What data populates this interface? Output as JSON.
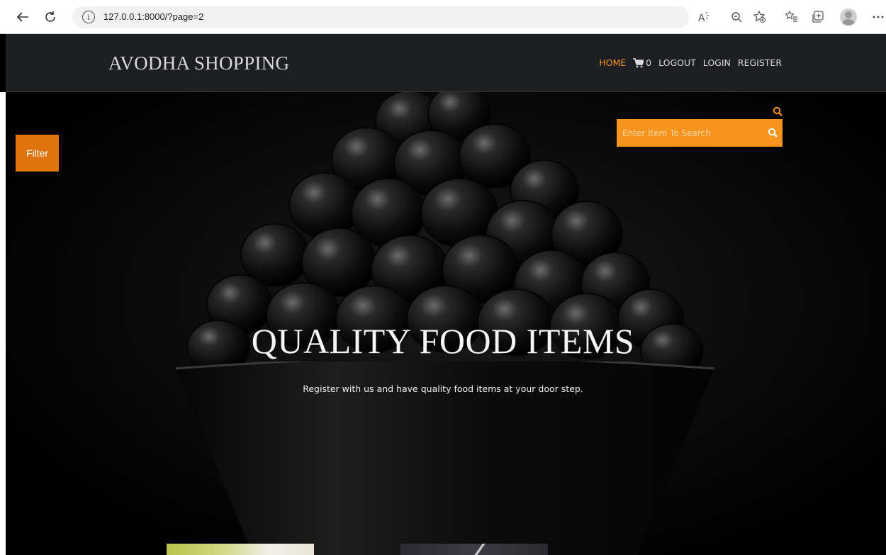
{
  "browser": {
    "url": "127.0.0.1:8000/?page=2",
    "back_icon": "arrow-left-icon",
    "refresh_icon": "refresh-icon",
    "info_icon_glyph": "i"
  },
  "header": {
    "brand": "AVODHA SHOPPING",
    "nav": {
      "home": "HOME",
      "cart_count": "0",
      "logout": "LOGOUT",
      "login": "LOGIN",
      "register": "REGISTER"
    },
    "active_color": "#f7941d"
  },
  "filter": {
    "label": "Filter"
  },
  "search": {
    "placeholder": "Enter Item To Search"
  },
  "hero": {
    "title": "QUALITY FOOD ITEMS",
    "subtitle": "Register with us and have quality food items at your door step."
  },
  "colors": {
    "accent": "#f7941d",
    "filter_bg": "#e0740c",
    "header_bg": "#1d1e21"
  }
}
